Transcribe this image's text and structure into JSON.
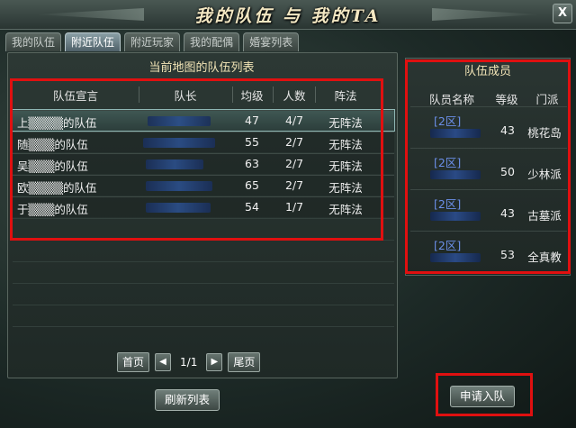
{
  "window": {
    "title": "我的队伍 与 我的TA",
    "close_label": "X"
  },
  "tabs": [
    {
      "label": "我的队伍"
    },
    {
      "label": "附近队伍"
    },
    {
      "label": "附近玩家"
    },
    {
      "label": "我的配偶"
    },
    {
      "label": "婚宴列表"
    }
  ],
  "team_list": {
    "title": "当前地图的队伍列表",
    "headers": {
      "declaration": "队伍宣言",
      "leader": "队长",
      "avg_level": "均级",
      "count": "人数",
      "formation": "阵法"
    },
    "rows": [
      {
        "declaration": "上▒▒▒▒的队伍",
        "avg_level": "47",
        "count": "4/7",
        "formation": "无阵法"
      },
      {
        "declaration": "随▒▒▒的队伍",
        "avg_level": "55",
        "count": "2/7",
        "formation": "无阵法"
      },
      {
        "declaration": "吴▒▒▒的队伍",
        "avg_level": "63",
        "count": "2/7",
        "formation": "无阵法"
      },
      {
        "declaration": "欧▒▒▒▒的队伍",
        "avg_level": "65",
        "count": "2/7",
        "formation": "无阵法"
      },
      {
        "declaration": "于▒▒▒的队伍",
        "avg_level": "54",
        "count": "1/7",
        "formation": "无阵法"
      }
    ]
  },
  "pager": {
    "first": "首页",
    "prev": "◀",
    "page_info": "1/1",
    "next": "▶",
    "last": "尾页"
  },
  "refresh_button": "刷新列表",
  "members": {
    "title": "队伍成员",
    "headers": {
      "name": "队员名称",
      "level": "等级",
      "school": "门派"
    },
    "rows": [
      {
        "server": "[2区]",
        "level": "43",
        "school": "桃花岛"
      },
      {
        "server": "[2区]",
        "level": "50",
        "school": "少林派"
      },
      {
        "server": "[2区]",
        "level": "43",
        "school": "古墓派"
      },
      {
        "server": "[2区]",
        "level": "53",
        "school": "全真教"
      }
    ]
  },
  "apply_button": "申请入队",
  "colors": {
    "highlight_box": "#e01010",
    "title_gold": "#f3e7c2",
    "server_blue": "#6b8fe8"
  }
}
